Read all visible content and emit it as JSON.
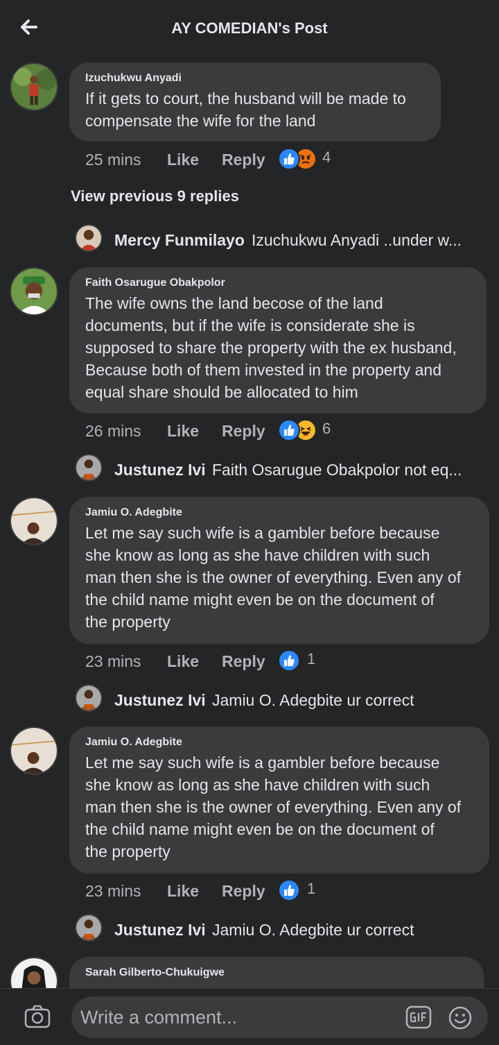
{
  "header": {
    "title": "AY COMEDIAN's Post",
    "back_icon": "arrow-left-icon"
  },
  "comments": [
    {
      "author": "Izuchukwu Anyadi",
      "lines": [
        "If it gets to court, the husband will be made to",
        "compensate the wife for the land"
      ],
      "time": "25 mins",
      "like": "Like",
      "reply": "Reply",
      "reactions": [
        "like",
        "angry"
      ],
      "reaction_count": "4"
    },
    {
      "author": "Faith Osarugue Obakpolor",
      "lines": [
        "The wife owns the land becose of the land",
        "documents, but if the wife is considerate she is",
        "supposed to share the property with the ex husband,",
        "Because both of them invested in the property and",
        "equal share should be allocated to him"
      ],
      "time": "26 mins",
      "like": "Like",
      "reply": "Reply",
      "reactions": [
        "like",
        "haha"
      ],
      "reaction_count": "6"
    },
    {
      "author": "Jamiu O. Adegbite",
      "lines": [
        "Let me say such wife is a gambler before because",
        "she know as long as she have children with such",
        "man then she is the owner of everything. Even any of",
        "the child name might even be on the document of",
        "the property"
      ],
      "time": "23 mins",
      "like": "Like",
      "reply": "Reply",
      "reactions": [
        "like"
      ],
      "reaction_count": "1"
    },
    {
      "author": "Jamiu O. Adegbite",
      "lines": [
        "Let me say such wife is a gambler before because",
        "she know as long as she have children with such",
        "man then she is the owner of everything. Even any of",
        "the child name might even be on the document of",
        "the property"
      ],
      "time": "23 mins",
      "like": "Like",
      "reply": "Reply",
      "reactions": [
        "like"
      ],
      "reaction_count": "1"
    },
    {
      "author": "Sarah Gilberto-Chukuigwe",
      "lines": [
        ""
      ]
    }
  ],
  "view_previous": "View previous 9 replies",
  "replies": [
    {
      "name": "Mercy Funmilayo",
      "text": "Izuchukwu Anyadi ..under w..."
    },
    {
      "name": "Justunez Ivi",
      "text": "Faith Osarugue Obakpolor not eq..."
    },
    {
      "name": "Justunez Ivi",
      "text": "Jamiu O. Adegbite ur correct"
    },
    {
      "name": "Justunez Ivi",
      "text": "Jamiu O. Adegbite ur correct"
    }
  ],
  "composer": {
    "placeholder": "Write a comment...",
    "camera_icon": "camera-icon",
    "gif_icon": "gif-icon",
    "emoji_icon": "emoji-icon"
  },
  "colors": {
    "background": "#242526",
    "bubble": "#3a3b3c",
    "like_blue": "#2d88ff",
    "muted_text": "#b0b3b8"
  }
}
